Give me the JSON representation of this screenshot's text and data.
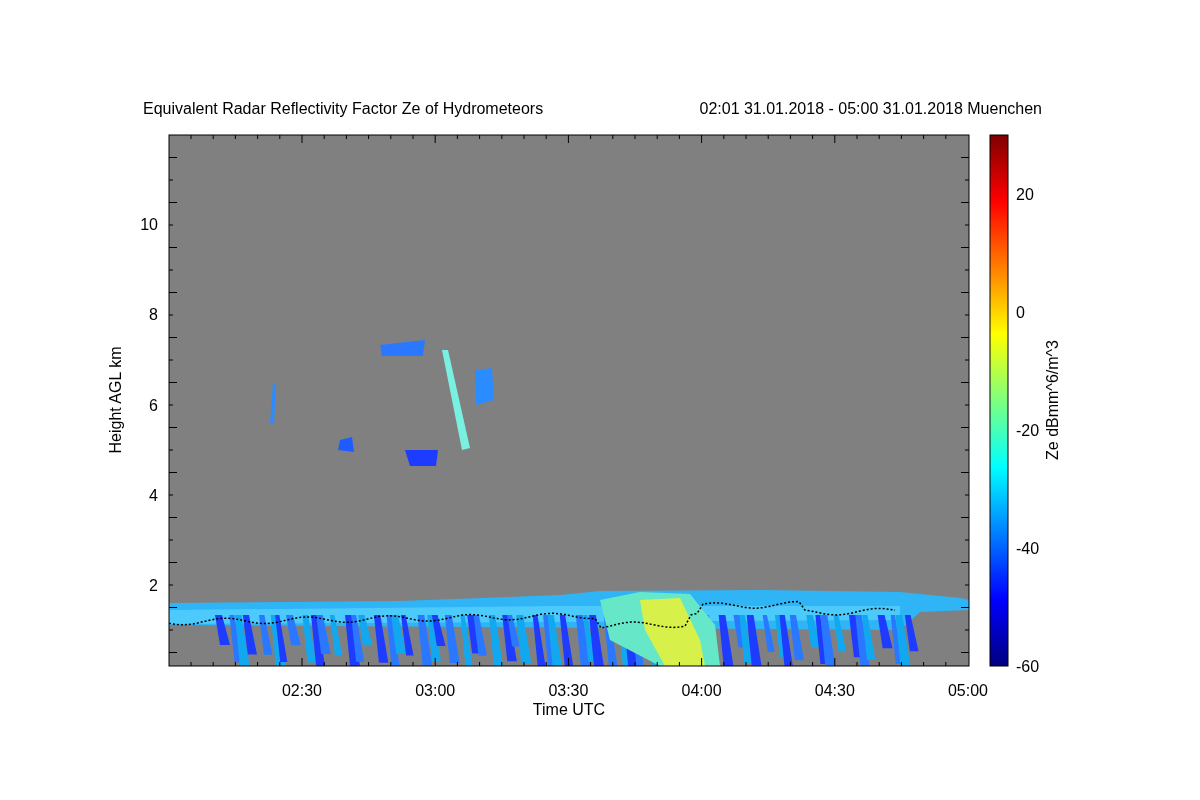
{
  "title": {
    "name": "Equivalent Radar Reflectivity Factor Ze of Hydrometeors",
    "period": "02:01 31.01.2018 - 05:00 31.01.2018 Muenchen"
  },
  "plot": {
    "xlabel": "Time UTC",
    "ylabel": "Height AGL km",
    "xticks": [
      "02:30",
      "03:00",
      "03:30",
      "04:00",
      "04:30",
      "05:00"
    ],
    "yticks": [
      "10",
      "8",
      "6",
      "4",
      "2"
    ]
  },
  "colorbar": {
    "label": "Ze dBmm^6/m^3",
    "ticks": [
      "20",
      "0",
      "-20",
      "-40",
      "-60"
    ]
  }
}
